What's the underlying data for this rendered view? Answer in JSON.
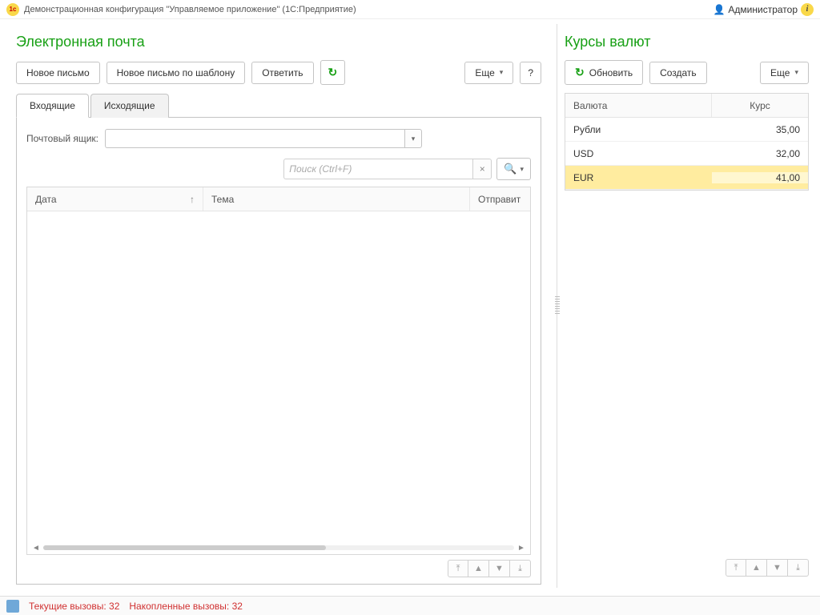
{
  "titlebar": {
    "title": "Демонстрационная конфигурация \"Управляемое приложение\"  (1С:Предприятие)",
    "user": "Администратор"
  },
  "email": {
    "heading": "Электронная почта",
    "toolbar": {
      "new_email": "Новое письмо",
      "new_template": "Новое письмо по шаблону",
      "reply": "Ответить",
      "more": "Еще",
      "help": "?"
    },
    "tabs": {
      "inbox": "Входящие",
      "outbox": "Исходящие"
    },
    "mailbox_label": "Почтовый ящик:",
    "mailbox_value": "",
    "search_placeholder": "Поиск (Ctrl+F)",
    "columns": {
      "date": "Дата",
      "subject": "Тема",
      "sender": "Отправит"
    }
  },
  "rates": {
    "heading": "Курсы валют",
    "toolbar": {
      "refresh": "Обновить",
      "create": "Создать",
      "more": "Еще"
    },
    "columns": {
      "currency": "Валюта",
      "rate": "Курс"
    },
    "rows": [
      {
        "currency": "Рубли",
        "rate": "35,00"
      },
      {
        "currency": "USD",
        "rate": "32,00"
      },
      {
        "currency": "EUR",
        "rate": "41,00"
      }
    ],
    "selected_index": 2
  },
  "status": {
    "current_calls_label": "Текущие вызовы:",
    "current_calls_value": "32",
    "accumulated_calls_label": "Накопленные вызовы:",
    "accumulated_calls_value": "32"
  }
}
